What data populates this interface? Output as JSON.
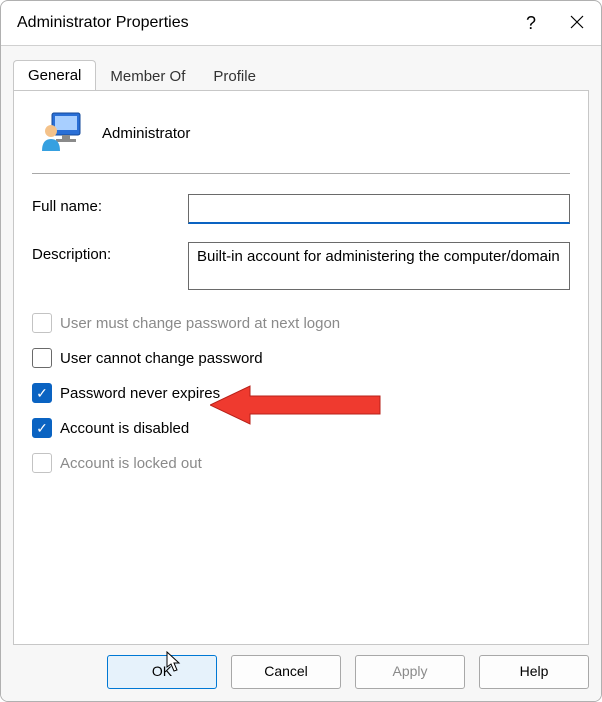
{
  "window": {
    "title": "Administrator Properties"
  },
  "tabs": {
    "general": "General",
    "member_of": "Member Of",
    "profile": "Profile"
  },
  "user": {
    "name": "Administrator"
  },
  "fields": {
    "full_name_label": "Full name:",
    "full_name_value": "",
    "description_label": "Description:",
    "description_value": "Built-in account for administering the computer/domain"
  },
  "checkboxes": {
    "must_change": {
      "label": "User must change password at next logon",
      "checked": false,
      "disabled": true
    },
    "cannot_change": {
      "label": "User cannot change password",
      "checked": false,
      "disabled": false
    },
    "never_expires": {
      "label": "Password never expires",
      "checked": true,
      "disabled": false
    },
    "disabled_account": {
      "label": "Account is disabled",
      "checked": true,
      "disabled": false
    },
    "locked_out": {
      "label": "Account is locked out",
      "checked": false,
      "disabled": true
    }
  },
  "buttons": {
    "ok": "OK",
    "cancel": "Cancel",
    "apply": "Apply",
    "help": "Help"
  }
}
